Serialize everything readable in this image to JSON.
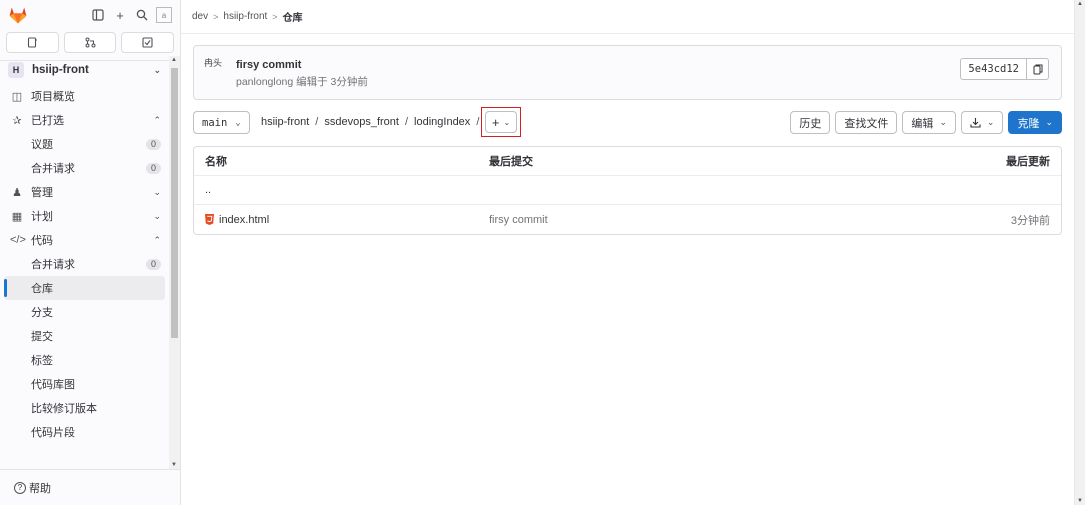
{
  "sidebar": {
    "project_initial": "H",
    "project_name": "hsiip-front",
    "avatar_alt": "a",
    "items": [
      {
        "label": "项目概览"
      },
      {
        "label": "已打选"
      },
      {
        "label": "议题",
        "count": "0"
      },
      {
        "label": "合并请求",
        "count": "0"
      },
      {
        "label": "管理"
      },
      {
        "label": "计划"
      },
      {
        "label": "代码"
      },
      {
        "label": "合并请求",
        "count": "0"
      },
      {
        "label": "仓库"
      },
      {
        "label": "分支"
      },
      {
        "label": "提交"
      },
      {
        "label": "标签"
      },
      {
        "label": "代码库图"
      },
      {
        "label": "比较修订版本"
      },
      {
        "label": "代码片段"
      }
    ],
    "help_label": "帮助"
  },
  "breadcrumb": [
    "dev",
    "hsiip-front",
    "仓库"
  ],
  "commit": {
    "avatar_text": "冉头",
    "title": "firsy commit",
    "meta": "panlonglong 编辑于 3分钟前",
    "sha": "5e43cd12"
  },
  "toolbar": {
    "branch": "main",
    "path": [
      "hsiip-front",
      "ssdevops_front",
      "lodingIndex"
    ],
    "history": "历史",
    "find_file": "查找文件",
    "edit": "编辑",
    "clone": "克隆"
  },
  "table": {
    "headers": {
      "name": "名称",
      "last_commit": "最后提交",
      "last_update": "最后更新"
    },
    "parent": "..",
    "rows": [
      {
        "name": "index.html",
        "commit": "firsy commit",
        "updated": "3分钟前"
      }
    ]
  },
  "colors": {
    "accent": "#1f75cb",
    "highlight_box": "#d02020"
  }
}
